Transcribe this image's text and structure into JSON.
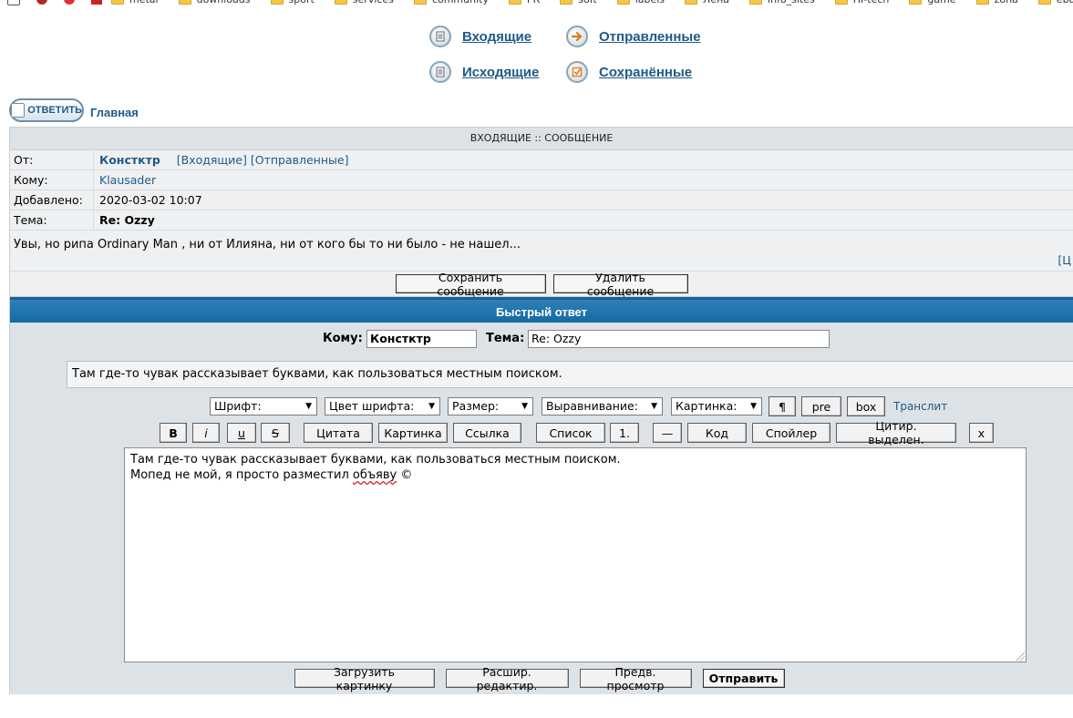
{
  "bookmarks": [
    "metal",
    "downloads",
    "sport",
    "services",
    "community",
    "PR",
    "soft",
    "labels",
    "Лена",
    "info_sites",
    "HI-tech",
    "game",
    "zona",
    "ebay"
  ],
  "nav": {
    "inbox": "Входящие",
    "sent": "Отправленные",
    "outbox": "Исходящие",
    "saved": "Сохранённые"
  },
  "reply_button": "ОТВЕТИТЬ",
  "home_link": "Главная",
  "message": {
    "header": "ВХОДЯЩИЕ :: СООБЩЕНИЕ",
    "from_label": "От:",
    "from_value": "Констктр",
    "from_inbox_link": "[Входящие]",
    "from_sent_link": "[Отправленные]",
    "to_label": "Кому:",
    "to_value": "Klausader",
    "date_label": "Добавлено:",
    "date_value": "2020-03-02 10:07",
    "subject_label": "Тема:",
    "subject_value": "Re: Ozzy",
    "body": "Увы, но рипа Ordinary Man , ни от Илияна, ни от кого бы то ни было - не нашел...",
    "quote_link": "[Ц",
    "save_button": "Сохранить сообщение",
    "delete_button": "Удалить сообщение"
  },
  "quick_reply": {
    "title": "Быстрый ответ",
    "to_label": "Кому:",
    "to_value": "Констктр",
    "subject_label": "Тема:",
    "subject_value": "Re: Ozzy",
    "quote_text": "Там где-то чувак рассказывает буквами, как пользоваться местным поиском.",
    "selects": {
      "font": "Шрифт:",
      "color": "Цвет шрифта:",
      "size": "Размер:",
      "align": "Выравнивание:",
      "image": "Картинка:"
    },
    "toolbar1": {
      "para": "¶",
      "pre": "pre",
      "box": "box",
      "translit": "Транслит"
    },
    "toolbar2": {
      "bold": "B",
      "italic": "i",
      "underline": "u",
      "strike": "S",
      "quote": "Цитата",
      "image": "Картинка",
      "link": "Ссылка",
      "list": "Список",
      "list_item": "1.",
      "hr": "—",
      "code": "Код",
      "spoiler": "Спойлер",
      "quote_selected": "Цитир. выделен.",
      "close": "x"
    },
    "editor_line1": "Там где-то чувак рассказывает буквами, как пользоваться местным поиском.",
    "editor_line2_prefix": "Мопед не мой, я просто разместил ",
    "editor_line2_misspelled": "объяву",
    "editor_line2_suffix": " ©",
    "upload_button": "Загрузить картинку",
    "advanced_button": "Расшир. редактир.",
    "preview_button": "Предв. просмотр",
    "send_button": "Отправить"
  }
}
